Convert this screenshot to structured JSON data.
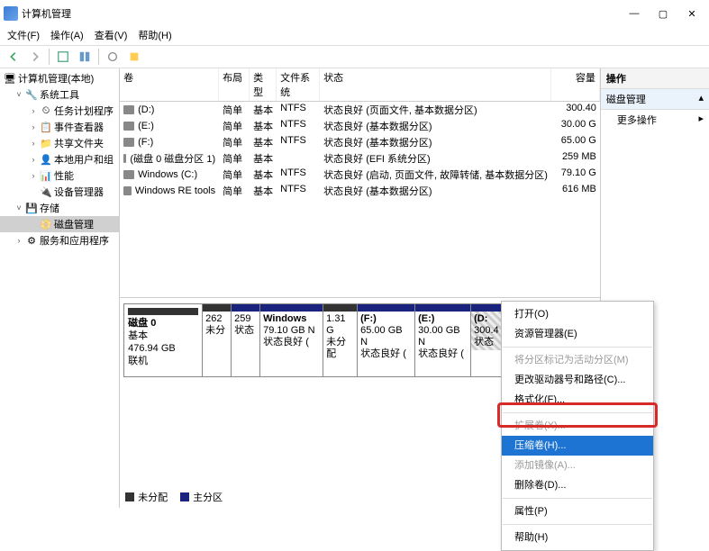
{
  "title": "计算机管理",
  "menubar": [
    "文件(F)",
    "操作(A)",
    "查看(V)",
    "帮助(H)"
  ],
  "tree": {
    "root": "计算机管理(本地)",
    "sys_tools": "系统工具",
    "task_scheduler": "任务计划程序",
    "event_viewer": "事件查看器",
    "shared_folders": "共享文件夹",
    "local_users": "本地用户和组",
    "performance": "性能",
    "device_mgr": "设备管理器",
    "storage": "存储",
    "disk_mgmt": "磁盘管理",
    "services": "服务和应用程序"
  },
  "vol_headers": {
    "vol": "卷",
    "layout": "布局",
    "type": "类型",
    "fs": "文件系统",
    "status": "状态",
    "cap": "容量"
  },
  "volumes": [
    {
      "name": "(D:)",
      "layout": "简单",
      "type": "基本",
      "fs": "NTFS",
      "status": "状态良好 (页面文件, 基本数据分区)",
      "cap": "300.40"
    },
    {
      "name": "(E:)",
      "layout": "简单",
      "type": "基本",
      "fs": "NTFS",
      "status": "状态良好 (基本数据分区)",
      "cap": "30.00 G"
    },
    {
      "name": "(F:)",
      "layout": "简单",
      "type": "基本",
      "fs": "NTFS",
      "status": "状态良好 (基本数据分区)",
      "cap": "65.00 G"
    },
    {
      "name": "(磁盘 0 磁盘分区 1)",
      "layout": "简单",
      "type": "基本",
      "fs": "",
      "status": "状态良好 (EFI 系统分区)",
      "cap": "259 MB"
    },
    {
      "name": "Windows (C:)",
      "layout": "简单",
      "type": "基本",
      "fs": "NTFS",
      "status": "状态良好 (启动, 页面文件, 故障转储, 基本数据分区)",
      "cap": "79.10 G"
    },
    {
      "name": "Windows RE tools",
      "layout": "简单",
      "type": "基本",
      "fs": "NTFS",
      "status": "状态良好 (基本数据分区)",
      "cap": "616 MB"
    }
  ],
  "disk": {
    "label": "磁盘 0",
    "type": "基本",
    "size": "476.94 GB",
    "status": "联机"
  },
  "partitions": [
    {
      "title": "",
      "size": "262",
      "status": "未分",
      "w": "32",
      "unalloc": true
    },
    {
      "title": "",
      "size": "259",
      "status": "状态",
      "w": "32"
    },
    {
      "title": "Windows",
      "size": "79.10 GB N",
      "status": "状态良好 (",
      "w": "70"
    },
    {
      "title": "",
      "size": "1.31 G",
      "status": "未分配",
      "w": "38",
      "unalloc": true
    },
    {
      "title": "(F:)",
      "size": "65.00 GB N",
      "status": "状态良好 (",
      "w": "64"
    },
    {
      "title": "(E:)",
      "size": "30.00 GB N",
      "status": "状态良好 (",
      "w": "62"
    },
    {
      "title": "(D:",
      "size": "300.4",
      "status": "状态",
      "w": "38",
      "hatched": true
    }
  ],
  "legend": {
    "unalloc": "未分配",
    "primary": "主分区"
  },
  "right": {
    "header": "操作",
    "section": "磁盘管理",
    "more": "更多操作"
  },
  "context_menu": [
    {
      "label": "打开(O)",
      "en": true
    },
    {
      "label": "资源管理器(E)",
      "en": true
    },
    {
      "sep": true
    },
    {
      "label": "将分区标记为活动分区(M)",
      "en": false
    },
    {
      "label": "更改驱动器号和路径(C)...",
      "en": true
    },
    {
      "label": "格式化(F)...",
      "en": true
    },
    {
      "sep": true
    },
    {
      "label": "扩展卷(X)...",
      "en": false
    },
    {
      "label": "压缩卷(H)...",
      "en": true,
      "sel": true
    },
    {
      "label": "添加镜像(A)...",
      "en": false
    },
    {
      "label": "删除卷(D)...",
      "en": true
    },
    {
      "sep": true
    },
    {
      "label": "属性(P)",
      "en": true
    },
    {
      "sep": true
    },
    {
      "label": "帮助(H)",
      "en": true
    }
  ]
}
